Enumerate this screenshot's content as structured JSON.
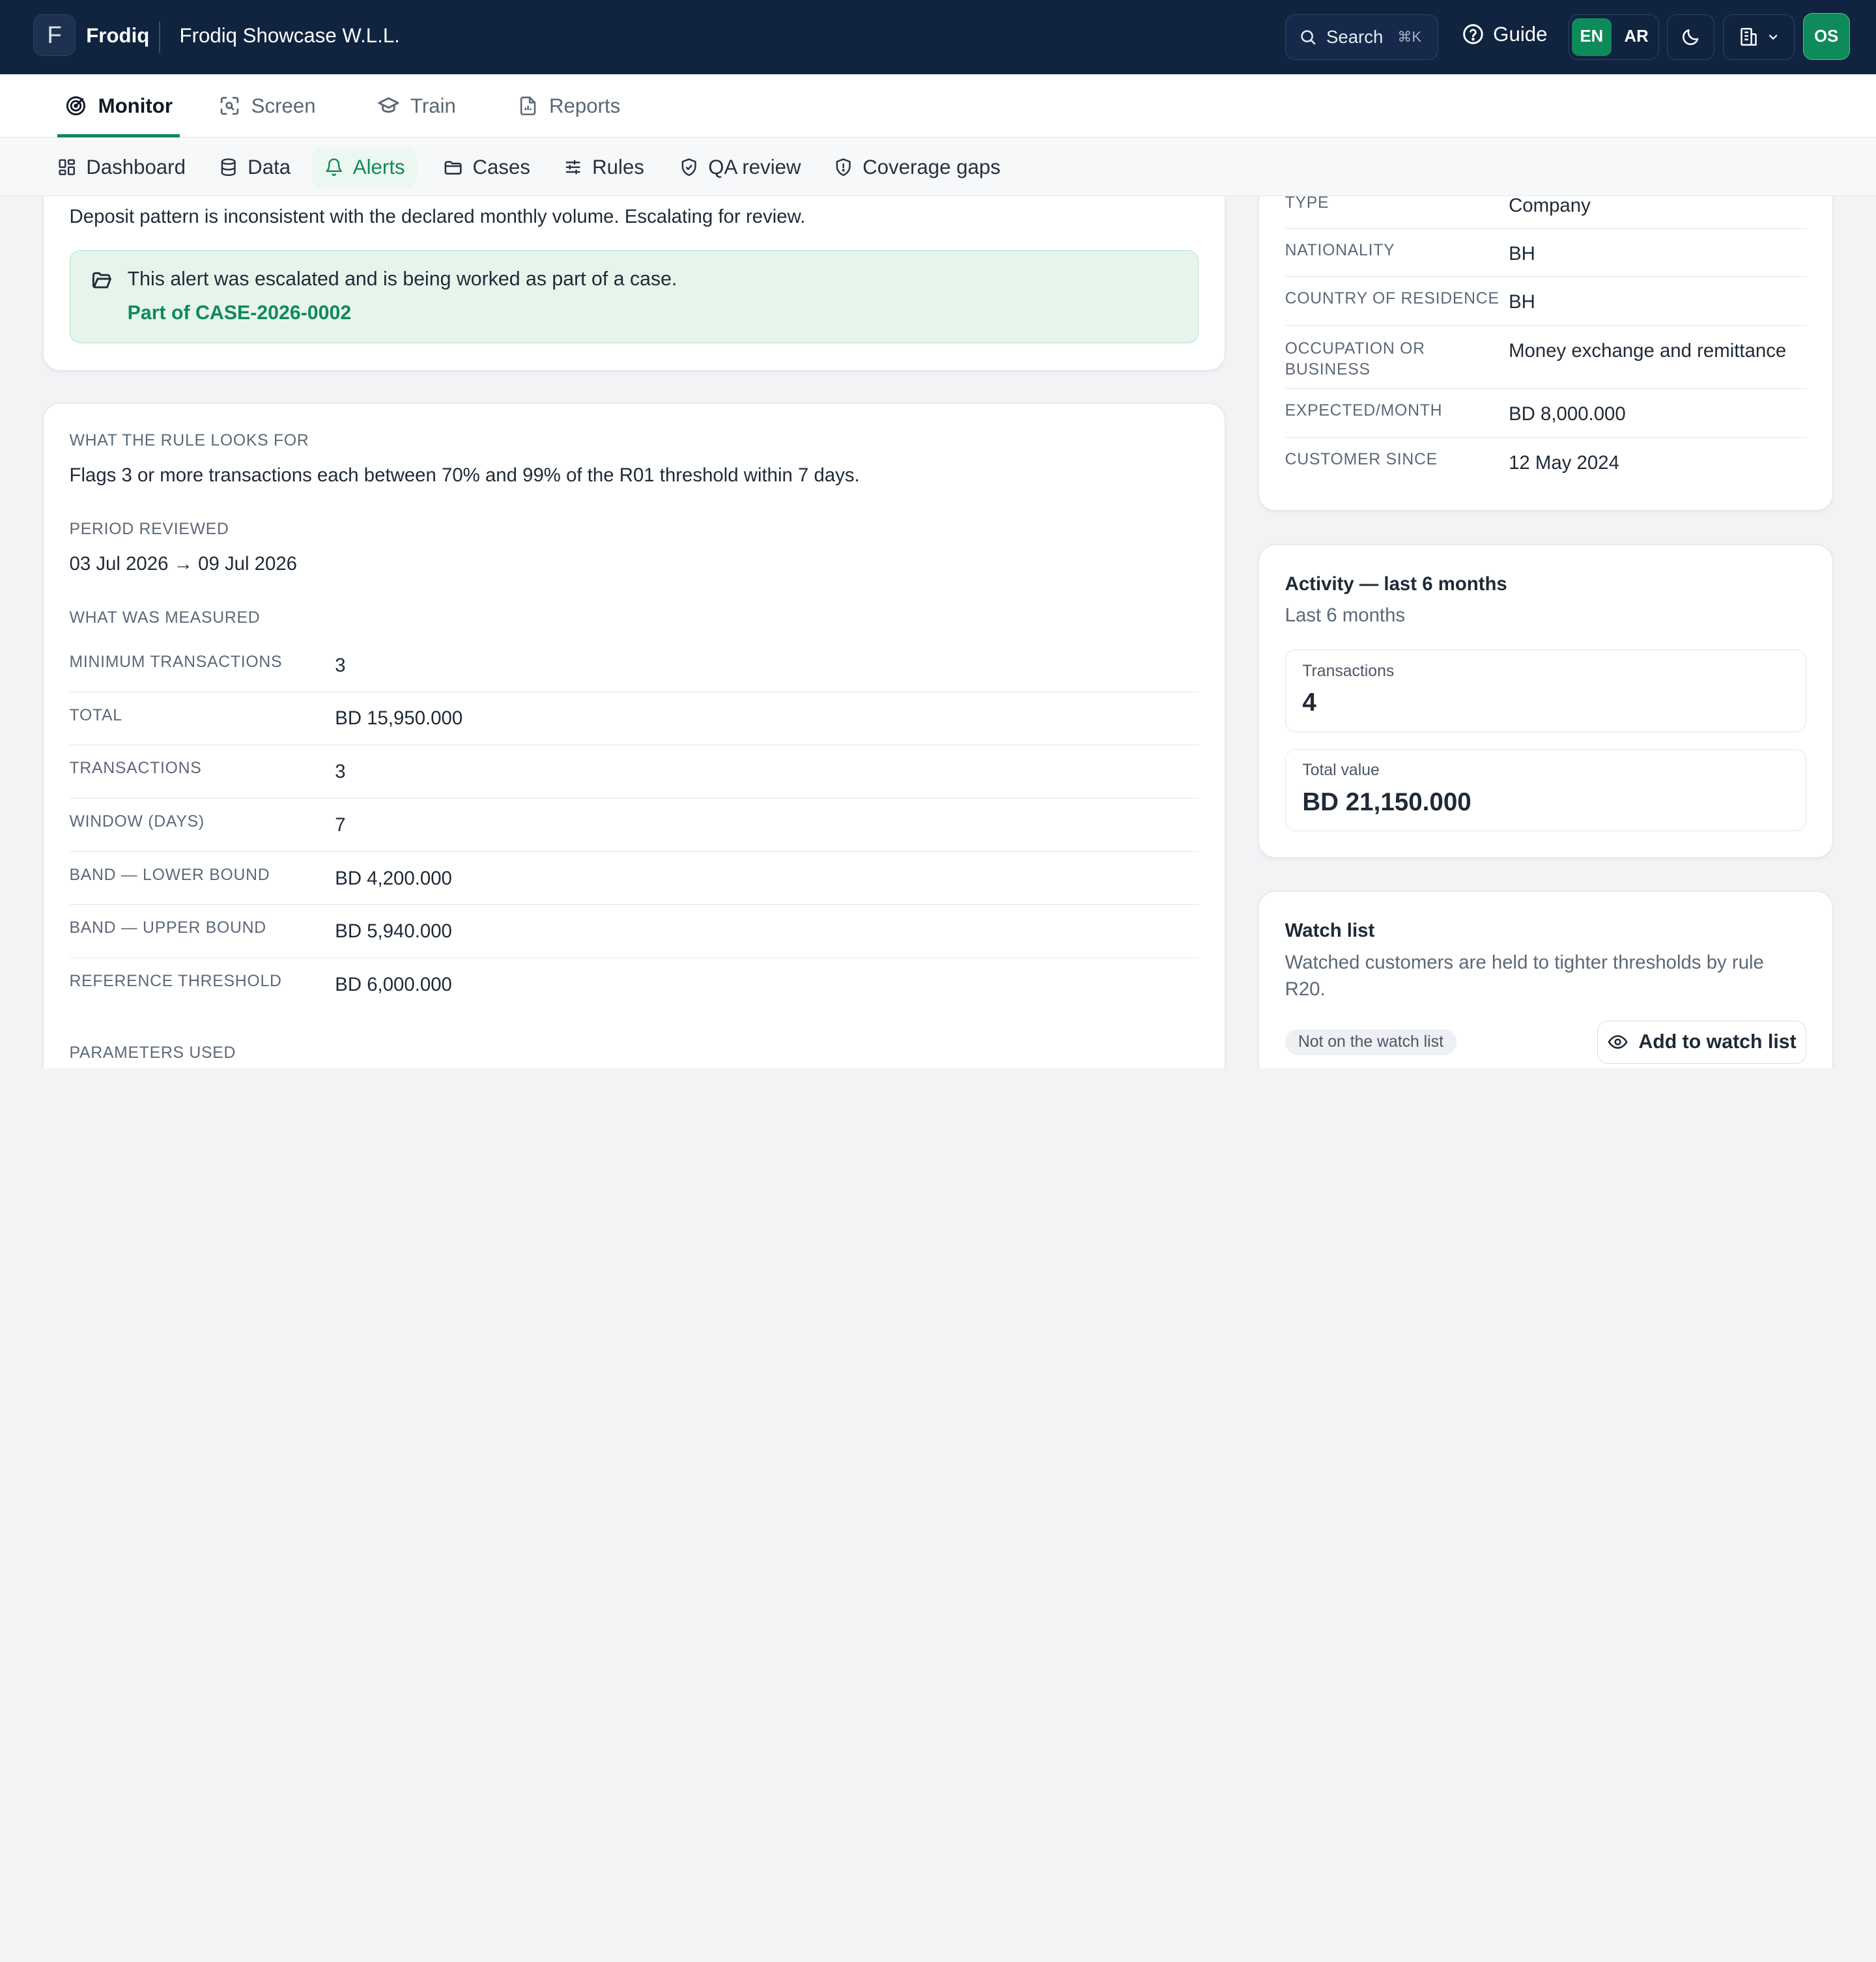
{
  "header": {
    "logo_letter": "F",
    "brand": "Frodiq",
    "org_name": "Frodiq Showcase W.L.L.",
    "search_label": "Search",
    "search_shortcut": "⌘K",
    "guide_label": "Guide",
    "languages": [
      "EN",
      "AR"
    ],
    "active_language": "EN",
    "avatar_initials": "OS"
  },
  "primary_nav": [
    {
      "label": "Monitor",
      "icon": "radar-icon",
      "active": true
    },
    {
      "label": "Screen",
      "icon": "scan-icon",
      "active": false
    },
    {
      "label": "Train",
      "icon": "graduation-cap-icon",
      "active": false
    },
    {
      "label": "Reports",
      "icon": "document-icon",
      "active": false
    }
  ],
  "secondary_nav": [
    {
      "label": "Dashboard",
      "icon": "grid-icon",
      "active": false
    },
    {
      "label": "Data",
      "icon": "database-icon",
      "active": false
    },
    {
      "label": "Alerts",
      "icon": "bell-icon",
      "active": true
    },
    {
      "label": "Cases",
      "icon": "folder-icon",
      "active": false
    },
    {
      "label": "Rules",
      "icon": "sliders-icon",
      "active": false
    },
    {
      "label": "QA review",
      "icon": "shield-check-icon",
      "active": false
    },
    {
      "label": "Coverage gaps",
      "icon": "shield-alert-icon",
      "active": false
    }
  ],
  "alert_note": {
    "text": "Deposit pattern is inconsistent with the declared monthly volume. Escalating for review.",
    "banner_text": "This alert was escalated and is being worked as part of a case.",
    "case_link": "Part of CASE-2026-0002"
  },
  "rule": {
    "looks_for_label": "WHAT THE RULE LOOKS FOR",
    "looks_for_text": "Flags 3 or more transactions each between 70% and 99% of the R01 threshold within 7 days.",
    "period_label": "PERIOD REVIEWED",
    "period_value": "03 Jul 2026 → 09 Jul 2026",
    "measured_label": "WHAT WAS MEASURED",
    "measurements": [
      {
        "label": "MINIMUM TRANSACTIONS",
        "value": "3"
      },
      {
        "label": "TOTAL",
        "value": "BD 15,950.000"
      },
      {
        "label": "TRANSACTIONS",
        "value": "3"
      },
      {
        "label": "WINDOW (DAYS)",
        "value": "7"
      },
      {
        "label": "BAND — LOWER BOUND",
        "value": "BD 4,200.000"
      },
      {
        "label": "BAND — UPPER BOUND",
        "value": "BD 5,940.000"
      },
      {
        "label": "REFERENCE THRESHOLD",
        "value": "BD 6,000.000"
      }
    ],
    "params_label": "PARAMETERS USED"
  },
  "customer": {
    "fields": [
      {
        "label": "TYPE",
        "value": "Company"
      },
      {
        "label": "NATIONALITY",
        "value": "BH"
      },
      {
        "label": "COUNTRY OF RESIDENCE",
        "value": "BH"
      },
      {
        "label": "OCCUPATION OR BUSINESS",
        "value": "Money exchange and remittance"
      },
      {
        "label": "EXPECTED/MONTH",
        "value": "BD 8,000.000"
      },
      {
        "label": "CUSTOMER SINCE",
        "value": "12 May 2024"
      }
    ]
  },
  "activity": {
    "title": "Activity — last 6 months",
    "subtitle": "Last 6 months",
    "transactions_label": "Transactions",
    "transactions_value": "4",
    "total_value_label": "Total value",
    "total_value": "BD 21,150.000"
  },
  "watchlist": {
    "title": "Watch list",
    "description": "Watched customers are held to tighter thresholds by rule R20.",
    "status": "Not on the watch list",
    "add_button": "Add to watch list"
  },
  "colors": {
    "topbar": "#10233f",
    "accent": "#0f8a5a",
    "banner_bg": "#e6f5ec"
  }
}
